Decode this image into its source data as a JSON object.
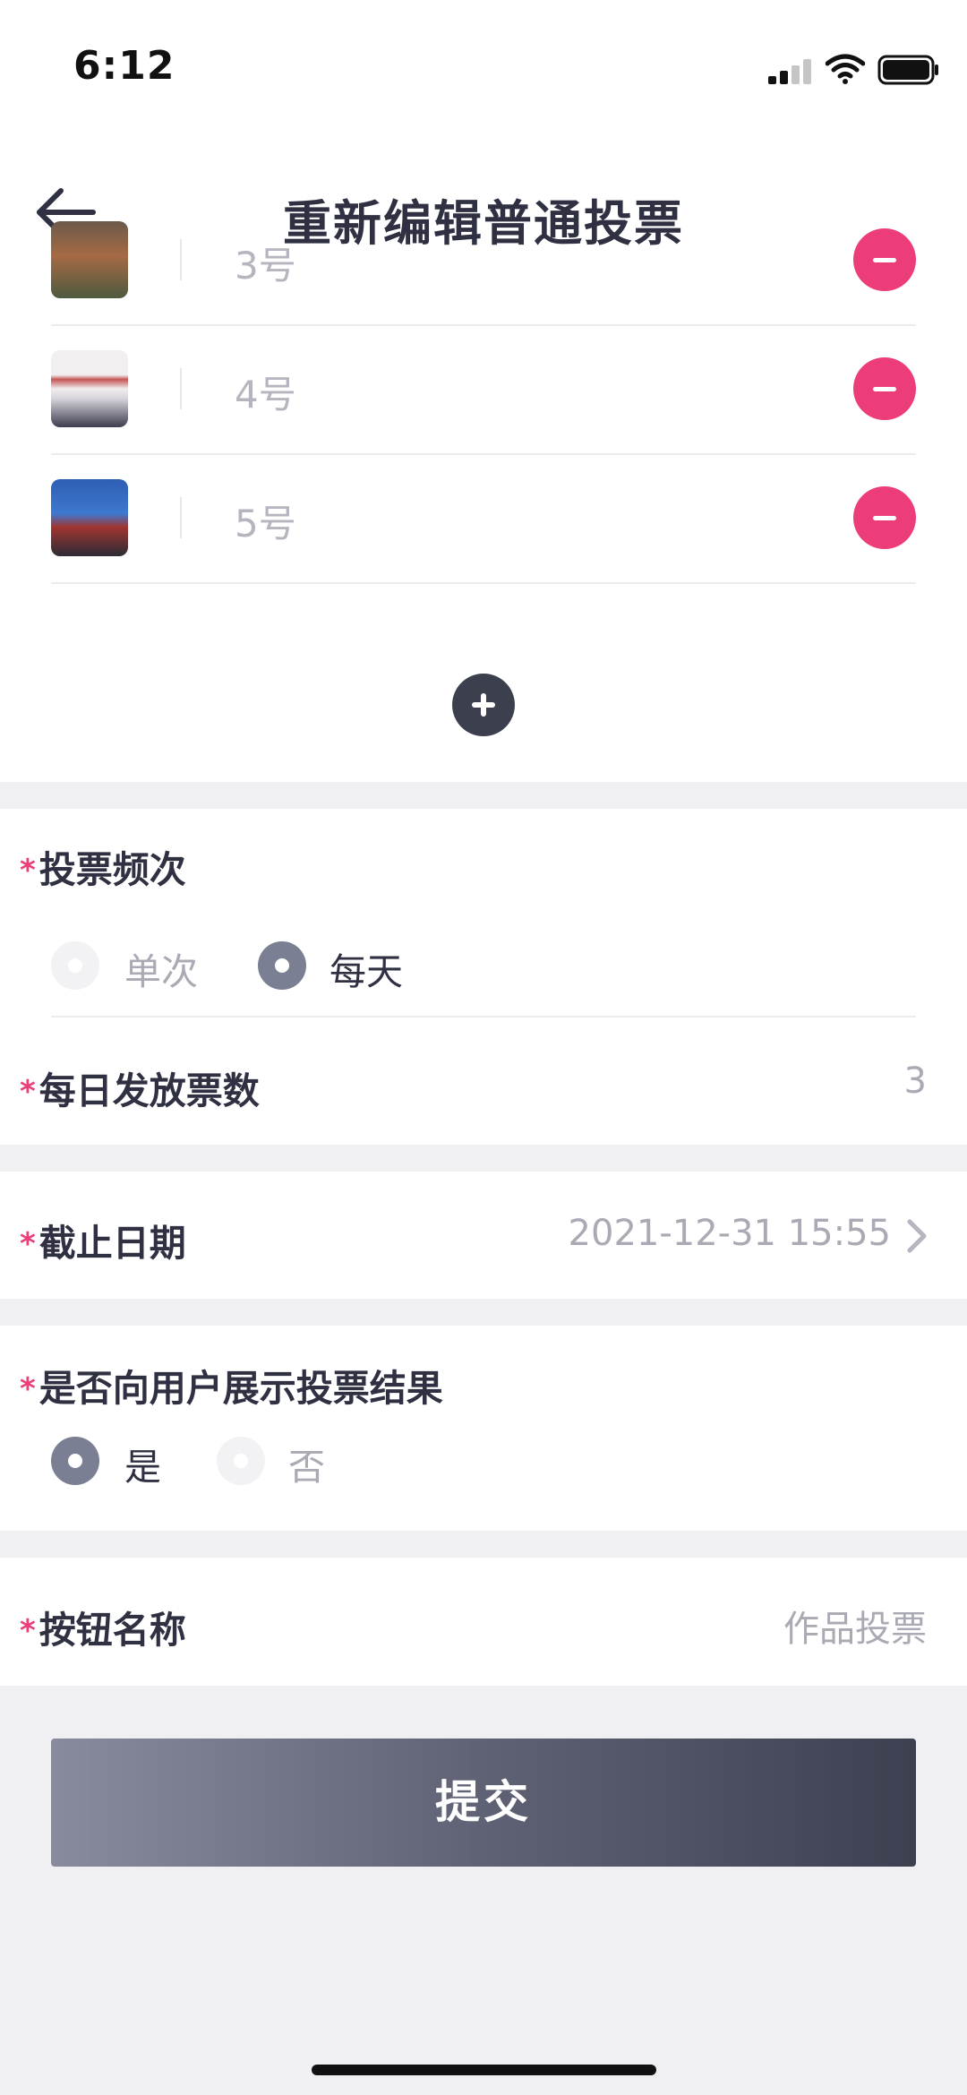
{
  "status_bar": {
    "time": "6:12"
  },
  "nav": {
    "title": "重新编辑普通投票"
  },
  "options": [
    {
      "label": "3号"
    },
    {
      "label": "4号"
    },
    {
      "label": "5号"
    }
  ],
  "vote_frequency": {
    "label": "投票频次",
    "choices": [
      {
        "label": "单次",
        "selected": false
      },
      {
        "label": "每天",
        "selected": true
      }
    ]
  },
  "daily_votes": {
    "label": "每日发放票数",
    "value": "3"
  },
  "deadline": {
    "label": "截止日期",
    "value": "2021-12-31 15:55"
  },
  "show_results": {
    "label": "是否向用户展示投票结果",
    "choices": [
      {
        "label": "是",
        "selected": true
      },
      {
        "label": "否",
        "selected": false
      }
    ]
  },
  "button_name": {
    "label": "按钮名称",
    "value": "作品投票"
  },
  "submit": {
    "label": "提交"
  },
  "colors": {
    "accent": "#ec3d7a",
    "dark": "#3c3f4d",
    "muted": "#a9aab3"
  }
}
